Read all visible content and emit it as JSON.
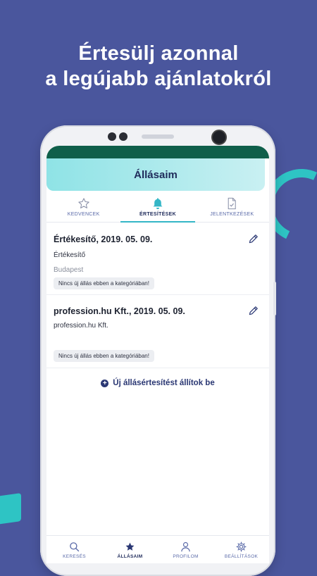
{
  "headline": {
    "line1": "Értesülj azonnal",
    "line2": "a legújabb ajánlatokról"
  },
  "header": {
    "title": "Állásaim"
  },
  "tabs": [
    {
      "label": "KEDVENCEK",
      "icon": "star-outline-icon"
    },
    {
      "label": "ÉRTESÍTÉSEK",
      "icon": "bell-icon",
      "active": true
    },
    {
      "label": "JELENTKEZÉSEK",
      "icon": "document-check-icon"
    }
  ],
  "alerts": [
    {
      "title": "Értékesítő, 2019. 05. 09.",
      "subtitle": "Értékesítő",
      "location": "Budapest",
      "status": "Nincs új állás ebben a kategóriában!"
    },
    {
      "title": "profession.hu Kft., 2019. 05. 09.",
      "subtitle": "profession.hu Kft.",
      "location": "",
      "status": "Nincs új állás ebben a kategóriában!"
    }
  ],
  "new_alert_label": "Új állásértesítést állítok be",
  "bottom_nav": [
    {
      "label": "KERESÉS",
      "icon": "search-icon"
    },
    {
      "label": "ÁLLÁSAIM",
      "icon": "star-icon",
      "active": true
    },
    {
      "label": "PROFILOM",
      "icon": "user-icon"
    },
    {
      "label": "BEÁLLÍTÁSOK",
      "icon": "gear-icon"
    }
  ],
  "colors": {
    "background": "#4a569d",
    "accent": "#34b6c6",
    "primary_text": "#1e2a5a"
  }
}
